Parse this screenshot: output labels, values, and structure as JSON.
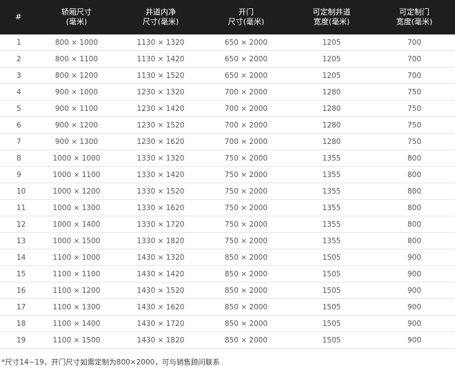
{
  "table": {
    "headers": [
      {
        "line1": "#",
        "line2": ""
      },
      {
        "line1": "轿厢尺寸",
        "line2": "(毫米)"
      },
      {
        "line1": "井道内净",
        "line2": "尺寸(毫米)"
      },
      {
        "line1": "开门",
        "line2": "尺寸(毫米)"
      },
      {
        "line1": "可定制井道",
        "line2": "宽度(毫米)"
      },
      {
        "line1": "可定制门",
        "line2": "宽度(毫米)"
      }
    ],
    "rows": [
      [
        "1",
        "800 × 1000",
        "1130 × 1320",
        "650 × 2000",
        "1205",
        "700"
      ],
      [
        "2",
        "800 × 1100",
        "1130 × 1420",
        "650 × 2000",
        "1205",
        "700"
      ],
      [
        "3",
        "800 × 1200",
        "1130 × 1520",
        "650 × 2000",
        "1205",
        "700"
      ],
      [
        "4",
        "900 × 1000",
        "1230 × 1320",
        "700 × 2000",
        "1280",
        "750"
      ],
      [
        "5",
        "900 × 1100",
        "1230 × 1420",
        "700 × 2000",
        "1280",
        "750"
      ],
      [
        "6",
        "900 × 1200",
        "1230 × 1520",
        "700 × 2000",
        "1280",
        "750"
      ],
      [
        "7",
        "900 × 1300",
        "1230 × 1620",
        "700 × 2000",
        "1280",
        "750"
      ],
      [
        "8",
        "1000 × 1000",
        "1330 × 1320",
        "750 × 2000",
        "1355",
        "800"
      ],
      [
        "9",
        "1000 × 1100",
        "1330 × 1420",
        "750 × 2000",
        "1355",
        "800"
      ],
      [
        "10",
        "1000 × 1200",
        "1330 × 1520",
        "750 × 2000",
        "1355",
        "800"
      ],
      [
        "11",
        "1000 × 1300",
        "1330 × 1620",
        "750 × 2000",
        "1355",
        "800"
      ],
      [
        "12",
        "1000 × 1400",
        "1330 × 1720",
        "750 × 2000",
        "1355",
        "800"
      ],
      [
        "13",
        "1000 × 1500",
        "1330 × 1820",
        "750 × 2000",
        "1355",
        "800"
      ],
      [
        "14",
        "1100 × 1000",
        "1430 × 1320",
        "850 × 2000",
        "1505",
        "900"
      ],
      [
        "15",
        "1100 × 1100",
        "1430 × 1420",
        "850 × 2000",
        "1505",
        "900"
      ],
      [
        "16",
        "1100 × 1200",
        "1430 × 1520",
        "850 × 2000",
        "1505",
        "900"
      ],
      [
        "17",
        "1100 × 1300",
        "1430 × 1620",
        "850 × 2000",
        "1505",
        "900"
      ],
      [
        "18",
        "1100 × 1400",
        "1430 × 1720",
        "850 × 2000",
        "1505",
        "900"
      ],
      [
        "19",
        "1100 × 1500",
        "1430 × 1820",
        "850 × 2000",
        "1505",
        "900"
      ]
    ]
  },
  "footnote": "*尺寸14~19，开门尺寸如需定制为800×2000，可与销售顾问联系",
  "colors": {
    "header_bg": "#1e1e1e",
    "header_text": "#ffffff",
    "cell_text": "#555555",
    "row_border": "#e4e4e4"
  }
}
